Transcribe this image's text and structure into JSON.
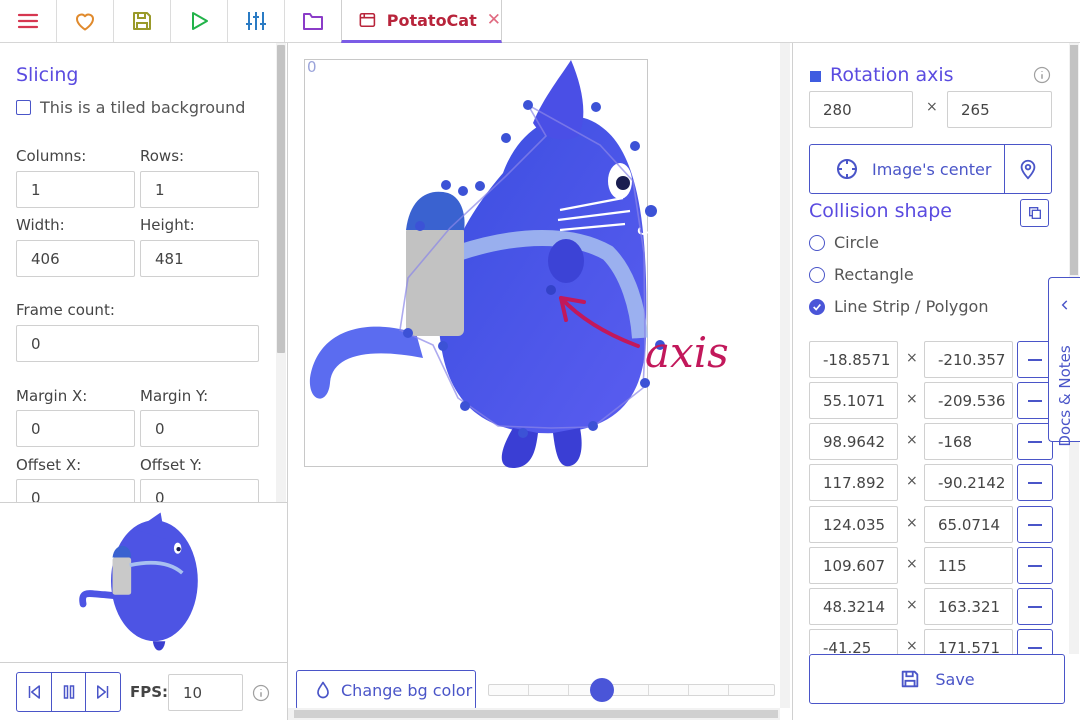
{
  "toolbar": {
    "buttons": [
      {
        "name": "menu-button",
        "icon": "menu-icon",
        "color": "#d63650"
      },
      {
        "name": "like-button",
        "icon": "heart-icon",
        "color": "#e08a2d"
      },
      {
        "name": "save-project-button",
        "icon": "floppy-icon",
        "color": "#9a9a2a"
      },
      {
        "name": "launch-button",
        "icon": "play-icon",
        "color": "#22b34a"
      },
      {
        "name": "settings-button",
        "icon": "sliders-icon",
        "color": "#2a7bc4"
      },
      {
        "name": "assets-button",
        "icon": "folder-icon",
        "color": "#8b3cc8"
      }
    ],
    "tab": {
      "label": "PotatoCat",
      "close": "✕",
      "accent": "#7b5ce6",
      "label_color": "#b8243b"
    }
  },
  "slicing": {
    "title": "Slicing",
    "tiled_label": "This is a tiled background",
    "tiled_checked": false,
    "columns_label": "Columns:",
    "columns": "1",
    "rows_label": "Rows:",
    "rows": "1",
    "width_label": "Width:",
    "width": "406",
    "height_label": "Height:",
    "height": "481",
    "frame_count_label": "Frame count:",
    "frame_count": "0",
    "margin_x_label": "Margin X:",
    "margin_x": "0",
    "margin_y_label": "Margin Y:",
    "margin_y": "0",
    "offset_x_label": "Offset X:",
    "offset_x": "0",
    "offset_y_label": "Offset Y:",
    "offset_y": "0"
  },
  "player": {
    "fps_label": "FPS:",
    "fps": "10"
  },
  "canvas": {
    "frame_index": "0",
    "annotation_text": "axis",
    "bg_button_label": "Change bg color",
    "zoom_level": 0.4
  },
  "rotation": {
    "title": "Rotation axis",
    "x": "280",
    "times": "×",
    "y": "265",
    "center_button_label": "Image's center"
  },
  "collision": {
    "title": "Collision shape",
    "options": [
      {
        "label": "Circle",
        "checked": false
      },
      {
        "label": "Rectangle",
        "checked": false
      },
      {
        "label": "Line Strip / Polygon",
        "checked": true
      }
    ],
    "points": [
      {
        "x": "-18.8571",
        "y": "-210.357"
      },
      {
        "x": "55.1071",
        "y": "-209.536"
      },
      {
        "x": "98.9642",
        "y": "-168"
      },
      {
        "x": "117.892",
        "y": "-90.2142"
      },
      {
        "x": "124.035",
        "y": "65.0714"
      },
      {
        "x": "109.607",
        "y": "115"
      },
      {
        "x": "48.3214",
        "y": "163.321"
      },
      {
        "x": "-41.25",
        "y": "171.571"
      }
    ],
    "save_label": "Save"
  },
  "docs": {
    "label": "Docs & Notes"
  },
  "colors": {
    "accent": "#4a55c8",
    "title": "#5a4be0",
    "cat_body": "#4d54e4",
    "annotation": "#c2185b"
  }
}
